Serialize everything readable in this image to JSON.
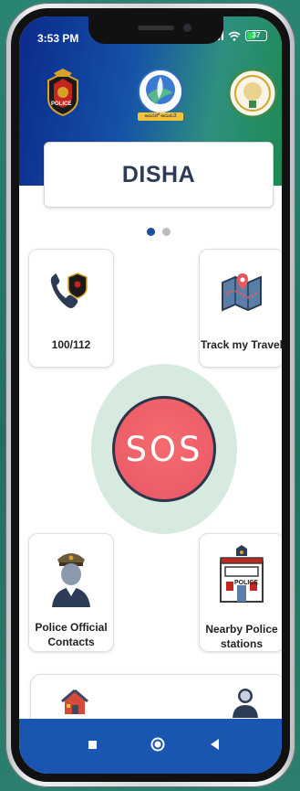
{
  "status_bar": {
    "time": "3:53 PM",
    "battery": "37"
  },
  "header": {
    "police_logo_text": "POLICE",
    "disha_logo_text": "ఆపదలో ఆదుకునే",
    "title": "DISHA"
  },
  "carousel": {
    "active_index": 0,
    "total": 2
  },
  "tiles": {
    "emergency_call_label": "100/112",
    "track_travel_label": "Track my Travel",
    "police_contacts_line1": "Police Official",
    "police_contacts_line2": "Contacts",
    "nearby_stations_line1": "Nearby Police",
    "nearby_stations_line2": "stations",
    "police_sign_text": "POLICE"
  },
  "sos": {
    "label": "SOS"
  },
  "colors": {
    "header_blue": "#0b2a8c",
    "header_green": "#1d8a52",
    "sos_red": "#ee5f6a",
    "dot_active": "#1c4fa3",
    "dot_inactive": "#bcbcbc",
    "nav_blue": "#1856b2"
  },
  "icons": {
    "home": "home-icon",
    "profile": "user-icon",
    "nav_square": "square-icon",
    "nav_circle": "circle-icon",
    "nav_back": "triangle-back-icon"
  }
}
